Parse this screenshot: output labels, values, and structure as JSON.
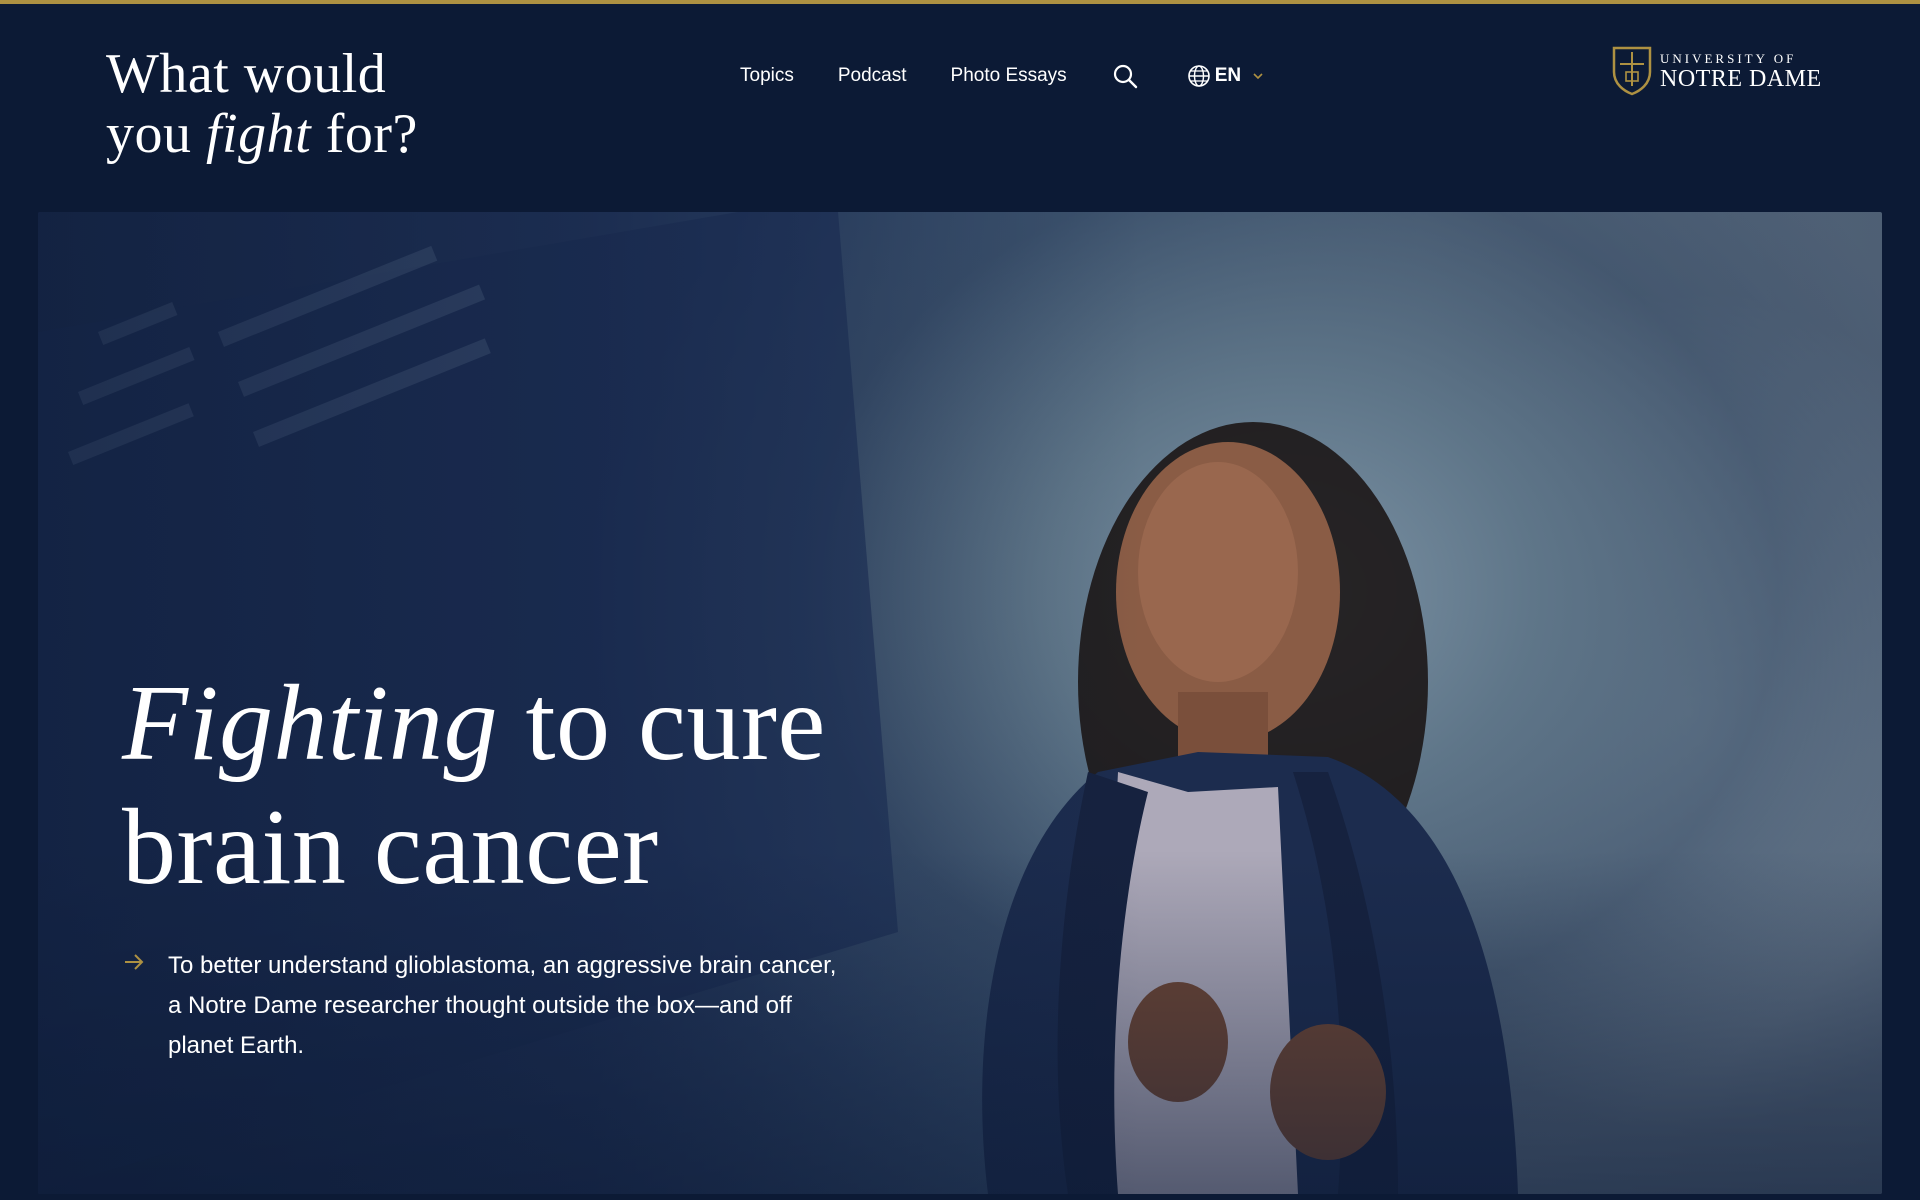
{
  "header": {
    "brand_line1": "What would",
    "brand_line2_a": "you ",
    "brand_line2_em": "fight",
    "brand_line2_b": " for?",
    "nav": {
      "topics": "Topics",
      "podcast": "Podcast",
      "photo_essays": "Photo Essays"
    },
    "search_icon": "search-icon",
    "language": "EN",
    "logo_line1": "UNIVERSITY OF",
    "logo_line2": "NOTRE DAME"
  },
  "hero": {
    "headline_em": "Fighting",
    "headline_rest1": " to cure",
    "headline_line2": "brain cancer",
    "dek": "To better understand glioblastoma, an aggressive brain cancer, a Notre Dame researcher thought outside the box—and off planet Earth.",
    "arrow_icon": "arrow-right-icon"
  },
  "colors": {
    "background": "#0c1a35",
    "accent_gold": "#ae9142",
    "text": "#ffffff"
  }
}
